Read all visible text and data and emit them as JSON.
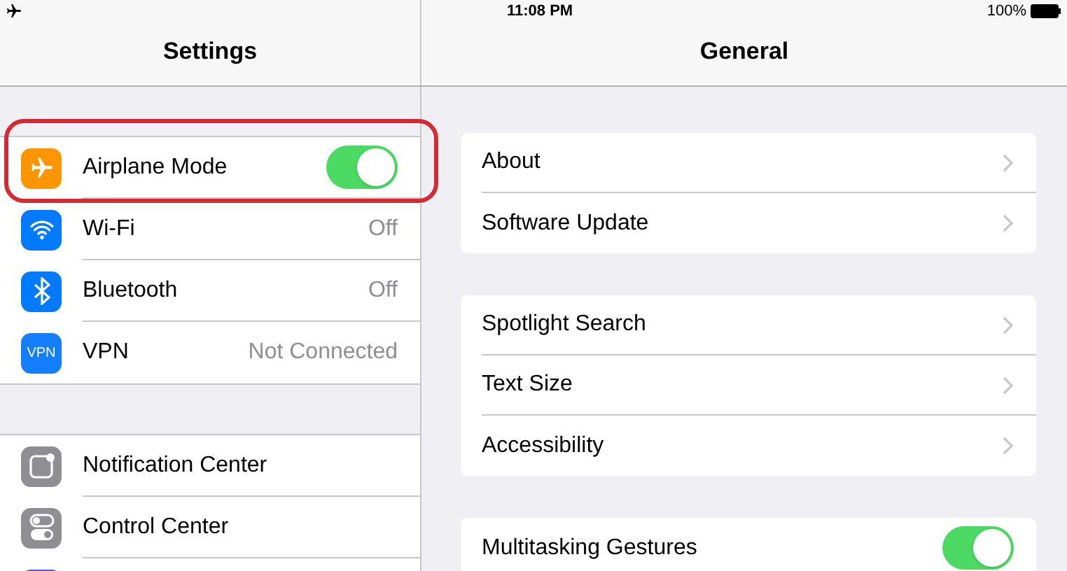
{
  "status_bar": {
    "airplane_mode": true,
    "time": "11:08 PM",
    "battery": "100%"
  },
  "sidebar": {
    "title": "Settings",
    "sections": [
      {
        "items": [
          {
            "kind": "toggle",
            "label": "Airplane Mode",
            "on": true,
            "color": "#ff9500",
            "highlighted": true
          },
          {
            "kind": "value",
            "label": "Wi-Fi",
            "value": "Off",
            "color": "#007aff"
          },
          {
            "kind": "value",
            "label": "Bluetooth",
            "value": "Off",
            "color": "#007aff"
          },
          {
            "kind": "value",
            "label": "VPN",
            "value": "Not Connected",
            "color": "#147efb",
            "icon_text": "VPN"
          }
        ]
      },
      {
        "items": [
          {
            "kind": "link",
            "label": "Notification Center",
            "color": "#8e8e93"
          },
          {
            "kind": "link",
            "label": "Control Center",
            "color": "#8e8e93"
          },
          {
            "kind": "link",
            "color": "#5856d6"
          }
        ]
      }
    ]
  },
  "detail": {
    "title": "General",
    "groups": [
      {
        "items": [
          {
            "kind": "link",
            "label": "About"
          },
          {
            "kind": "link",
            "label": "Software Update"
          }
        ]
      },
      {
        "items": [
          {
            "kind": "link",
            "label": "Spotlight Search"
          },
          {
            "kind": "link",
            "label": "Text Size"
          },
          {
            "kind": "link",
            "label": "Accessibility"
          }
        ]
      },
      {
        "items": [
          {
            "kind": "toggle",
            "label": "Multitasking Gestures",
            "on": true
          }
        ]
      }
    ]
  }
}
